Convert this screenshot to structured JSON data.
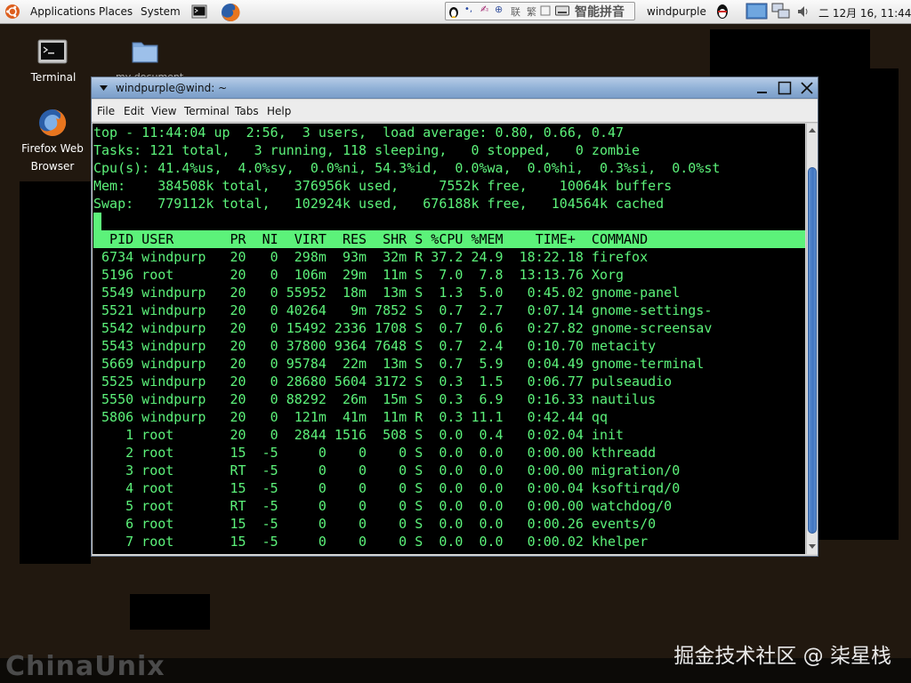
{
  "panel": {
    "menus": {
      "applications": "Applications",
      "places": "Places",
      "system": "System"
    },
    "ime_label": "智能拼音",
    "ime_chars": {
      "a": "联",
      "b": "繁"
    },
    "username": "windpurple",
    "clock": "二 12月 16, 11:44"
  },
  "desktop": {
    "icons": {
      "terminal": "Terminal",
      "firefox_line1": "Firefox Web",
      "firefox_line2": "Browser",
      "folder_partial": "my document"
    }
  },
  "window": {
    "title": "windpurple@wind: ~",
    "menu": {
      "file": "File",
      "edit": "Edit",
      "view": "View",
      "terminal": "Terminal",
      "tabs": "Tabs",
      "help": "Help"
    }
  },
  "top": {
    "summary": [
      "top - 11:44:04 up  2:56,  3 users,  load average: 0.80, 0.66, 0.47",
      "Tasks: 121 total,   3 running, 118 sleeping,   0 stopped,   0 zombie",
      "Cpu(s): 41.4%us,  4.0%sy,  0.0%ni, 54.3%id,  0.0%wa,  0.0%hi,  0.3%si,  0.0%st",
      "Mem:    384508k total,   376956k used,     7552k free,    10064k buffers",
      "Swap:   779112k total,   102924k used,   676188k free,   104564k cached"
    ],
    "header": "  PID USER       PR  NI  VIRT  RES  SHR S %CPU %MEM    TIME+  COMMAND",
    "processes": [
      " 6734 windpurp   20   0  298m  93m  32m R 37.2 24.9  18:22.18 firefox",
      " 5196 root       20   0  106m  29m  11m S  7.0  7.8  13:13.76 Xorg",
      " 5549 windpurp   20   0 55952  18m  13m S  1.3  5.0   0:45.02 gnome-panel",
      " 5521 windpurp   20   0 40264   9m 7852 S  0.7  2.7   0:07.14 gnome-settings-",
      " 5542 windpurp   20   0 15492 2336 1708 S  0.7  0.6   0:27.82 gnome-screensav",
      " 5543 windpurp   20   0 37800 9364 7648 S  0.7  2.4   0:10.70 metacity",
      " 5669 windpurp   20   0 95784  22m  13m S  0.7  5.9   0:04.49 gnome-terminal",
      " 5525 windpurp   20   0 28680 5604 3172 S  0.3  1.5   0:06.77 pulseaudio",
      " 5550 windpurp   20   0 88292  26m  15m S  0.3  6.9   0:16.33 nautilus",
      " 5806 windpurp   20   0  121m  41m  11m R  0.3 11.1   0:42.44 qq",
      "    1 root       20   0  2844 1516  508 S  0.0  0.4   0:02.04 init",
      "    2 root       15  -5     0    0    0 S  0.0  0.0   0:00.00 kthreadd",
      "    3 root       RT  -5     0    0    0 S  0.0  0.0   0:00.00 migration/0",
      "    4 root       15  -5     0    0    0 S  0.0  0.0   0:00.04 ksoftirqd/0",
      "    5 root       RT  -5     0    0    0 S  0.0  0.0   0:00.00 watchdog/0",
      "    6 root       15  -5     0    0    0 S  0.0  0.0   0:00.26 events/0",
      "    7 root       15  -5     0    0    0 S  0.0  0.0   0:00.02 khelper"
    ]
  },
  "watermark": "掘金技术社区 @ 柒星栈",
  "logo": "ChinaUnix"
}
